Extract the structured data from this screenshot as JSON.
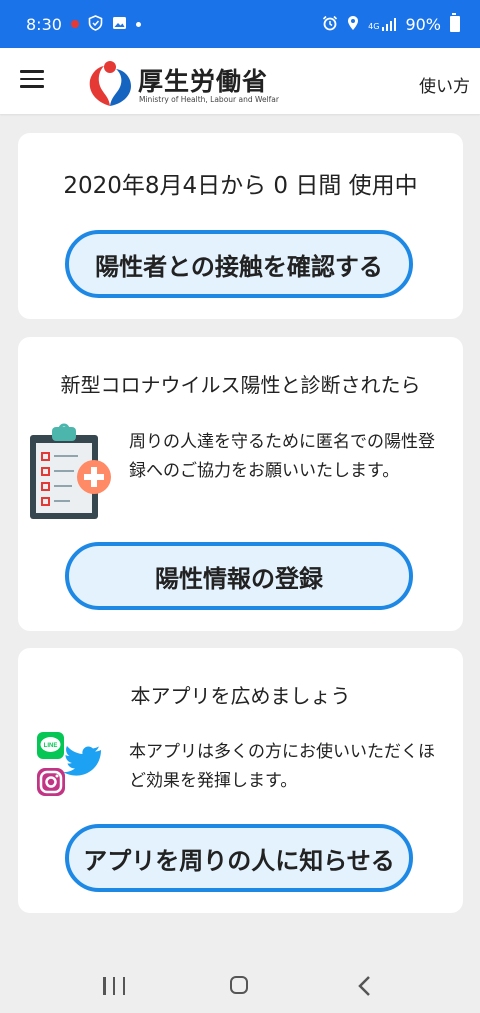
{
  "status_bar": {
    "time": "8:30",
    "network": "4G",
    "battery": "90%",
    "icons": [
      "notification-dot-icon",
      "shield-icon",
      "image-icon",
      "more-dot-icon",
      "alarm-icon",
      "location-icon",
      "signal-icon",
      "battery-icon"
    ]
  },
  "app_bar": {
    "logo_title": "厚生労働省",
    "logo_subtitle": "Ministry of Health, Labour and Welfar",
    "help_label": "使い方",
    "menu_icon": "hamburger-menu-icon"
  },
  "usage_card": {
    "usage_text": "2020年8月4日から 0 日間 使用中",
    "check_button_label": "陽性者との接触を確認する"
  },
  "positive_card": {
    "title": "新型コロナウイルス陽性と診断されたら",
    "body": "周りの人達を守るために匿名での陽性登録へのご協力をお願いいたします。",
    "register_button_label": "陽性情報の登録",
    "illustration_icon": "clipboard-medical-icon"
  },
  "share_card": {
    "title": "本アプリを広めましょう",
    "body": "本アプリは多くの方にお使いいただくほど効果を発揮します。",
    "share_button_label": "アプリを周りの人に知らせる",
    "sns_icons": [
      "line-icon",
      "twitter-icon",
      "instagram-icon"
    ],
    "line_label": "LINE"
  },
  "nav_bar": {
    "icons": [
      "recent-apps-icon",
      "home-icon",
      "back-icon"
    ]
  },
  "colors": {
    "status_bar": "#1a73e8",
    "button_border": "#1e88e5",
    "button_fill": "#e3f2fd",
    "background": "#eeeeee",
    "logo_red": "#e53935",
    "logo_blue": "#1565c0"
  }
}
